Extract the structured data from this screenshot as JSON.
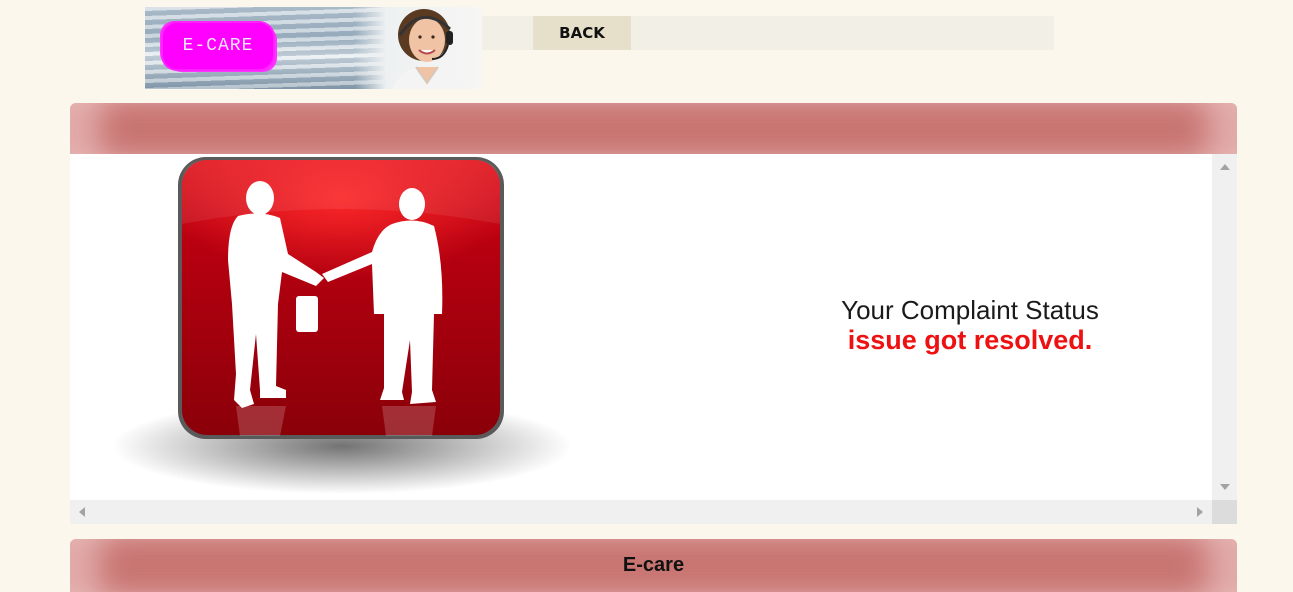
{
  "header": {
    "logo_text": "E-CARE",
    "back_label": "BACK"
  },
  "content": {
    "illustration_icon": "handshake-icon",
    "status_label": "Your Complaint Status",
    "status_value": "issue got resolved."
  },
  "footer": {
    "text": "E-care"
  },
  "colors": {
    "background": "#fcf7ec",
    "bar": "#c97673",
    "status_value": "#ee1111",
    "logo_badge": "#ff00ff"
  }
}
